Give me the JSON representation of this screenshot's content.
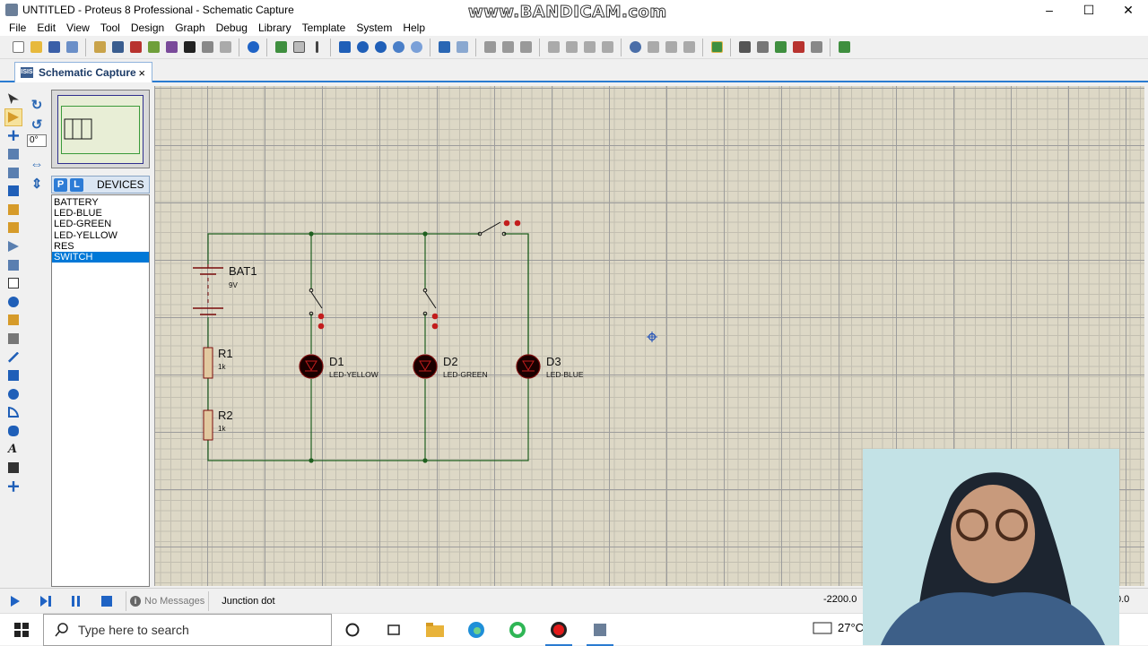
{
  "window": {
    "title": "UNTITLED - Proteus 8 Professional - Schematic Capture",
    "watermark": "www.BANDICAM.com",
    "controls": [
      "–",
      "☐",
      "✕"
    ]
  },
  "menu": [
    "File",
    "Edit",
    "View",
    "Tool",
    "Design",
    "Graph",
    "Debug",
    "Library",
    "Template",
    "System",
    "Help"
  ],
  "tab": {
    "label": "Schematic Capture",
    "close": "×",
    "icon_text": "ISIS"
  },
  "rotation": {
    "value": "0°"
  },
  "devices": {
    "header": "DEVICES",
    "p_button": "P",
    "l_button": "L",
    "items": [
      "BATTERY",
      "LED-BLUE",
      "LED-GREEN",
      "LED-YELLOW",
      "RES",
      "SWITCH"
    ],
    "selected": "SWITCH"
  },
  "schematic": {
    "battery": {
      "ref": "BAT1",
      "value": "9V"
    },
    "r1": {
      "ref": "R1",
      "value": "1k"
    },
    "r2": {
      "ref": "R2",
      "value": "1k"
    },
    "d1": {
      "ref": "D1",
      "value": "LED-YELLOW"
    },
    "d2": {
      "ref": "D2",
      "value": "LED-GREEN"
    },
    "d3": {
      "ref": "D3",
      "value": "LED-BLUE"
    },
    "colors": {
      "wire": "#1f5f1f",
      "component": "#7a0b0b",
      "pin": "#c21d1d"
    }
  },
  "status": {
    "messages": "No Messages",
    "hint": "Junction dot",
    "coord_x": "-2200.0",
    "coord_y": "0.0"
  },
  "taskbar": {
    "search_placeholder": "Type here to search",
    "temperature": "27°C"
  }
}
